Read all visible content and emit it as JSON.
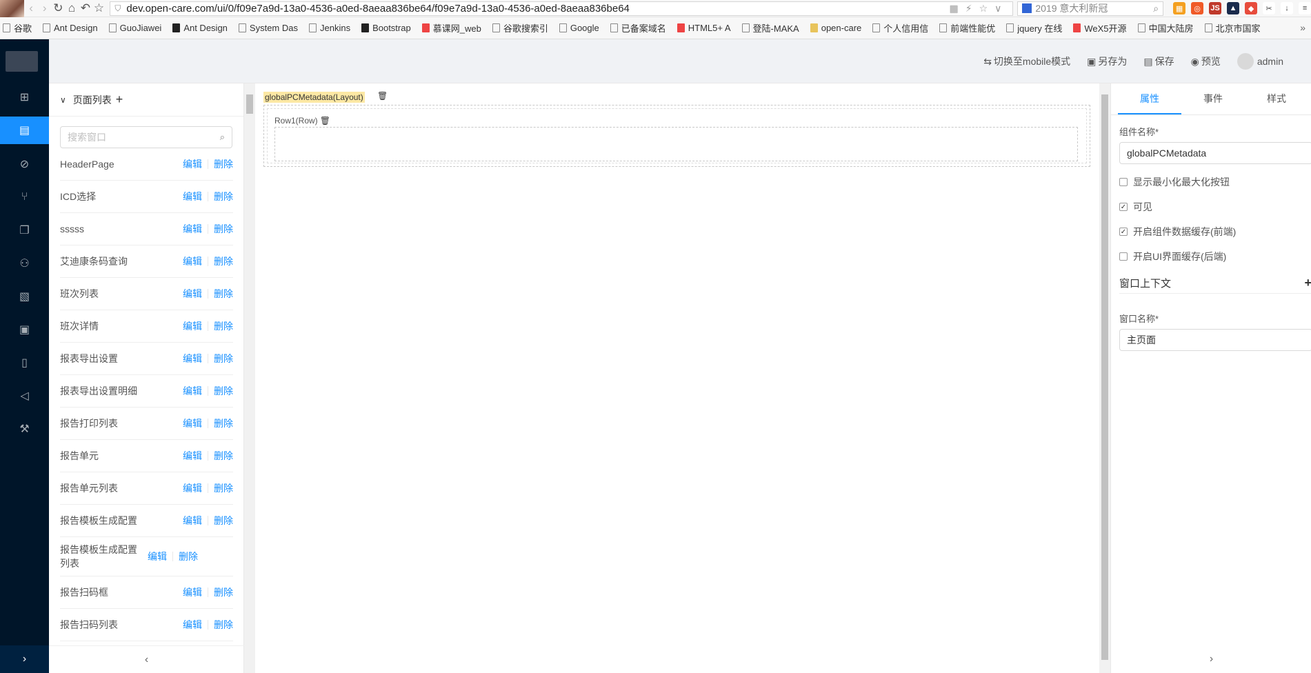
{
  "browser": {
    "url": "dev.open-care.com/ui/0/f09e7a9d-13a0-4536-a0ed-8aeaa836be64/f09e7a9d-13a0-4536-a0ed-8aeaa836be64",
    "search_text": "2019 意大利新冠",
    "bookmarks": [
      "谷歌",
      "Ant Design",
      "GuoJiawei",
      "Ant Design",
      "System Das",
      "Jenkins",
      "Bootstrap",
      "慕课网_web",
      "谷歌搜索引",
      "Google",
      "已备案域名",
      "HTML5+ A",
      "登陆-MAKA",
      "open-care",
      "个人信用信",
      "前端性能优",
      "jquery 在线",
      "WeX5开源",
      "中国大陆房",
      "北京市国家"
    ]
  },
  "topbar": {
    "switch_mobile": "切换至mobile模式",
    "save_as": "另存为",
    "save": "保存",
    "preview": "预览",
    "user": "admin"
  },
  "page_panel": {
    "title": "页面列表",
    "search_placeholder": "搜索窗口",
    "edit_label": "编辑",
    "delete_label": "删除",
    "pages": [
      "HeaderPage",
      "ICD选择",
      "sssss",
      "艾迪康条码查询",
      "班次列表",
      "班次详情",
      "报表导出设置",
      "报表导出设置明细",
      "报告打印列表",
      "报告单元",
      "报告单元列表",
      "报告模板生成配置",
      "报告模板生成配置列表",
      "报告扫码框",
      "报告扫码列表"
    ]
  },
  "canvas": {
    "layout_label": "globalPCMetadata(Layout)",
    "row_label": "Row1(Row)"
  },
  "props": {
    "tabs": [
      "属性",
      "事件",
      "样式"
    ],
    "component_name_label": "组件名称*",
    "component_name_value": "globalPCMetadata",
    "checks": [
      {
        "label": "显示最小化最大化按钮",
        "checked": false
      },
      {
        "label": "可见",
        "checked": true
      },
      {
        "label": "开启组件数据缓存(前端)",
        "checked": true
      },
      {
        "label": "开启UI界面缓存(后端)",
        "checked": false
      }
    ],
    "context_section": "窗口上下文",
    "window_name_label": "窗口名称*",
    "window_name_value": "主页面"
  }
}
